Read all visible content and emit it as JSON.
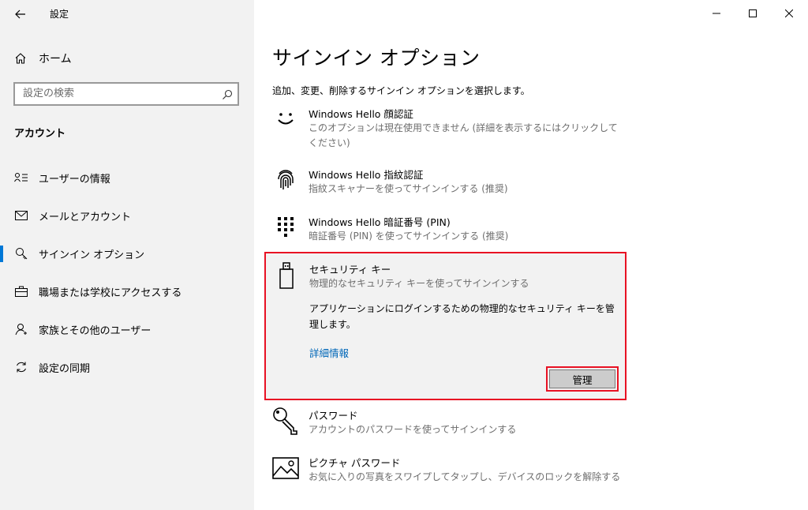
{
  "window": {
    "title": "設定",
    "back_icon": "arrow-left-icon",
    "controls": [
      "minimize-icon",
      "maximize-icon",
      "close-icon"
    ]
  },
  "sidebar": {
    "home_label": "ホーム",
    "search_placeholder": "設定の検索",
    "section_header": "アカウント",
    "items": [
      {
        "label": "ユーザーの情報",
        "icon": "user-info-icon",
        "active": false
      },
      {
        "label": "メールとアカウント",
        "icon": "mail-icon",
        "active": false
      },
      {
        "label": "サインイン オプション",
        "icon": "key-icon",
        "active": true
      },
      {
        "label": "職場または学校にアクセスする",
        "icon": "briefcase-icon",
        "active": false
      },
      {
        "label": "家族とその他のユーザー",
        "icon": "person-add-icon",
        "active": false
      },
      {
        "label": "設定の同期",
        "icon": "sync-icon",
        "active": false
      }
    ]
  },
  "main": {
    "title": "サインイン オプション",
    "description": "追加、変更、削除するサインイン オプションを選択します。",
    "options": [
      {
        "title": "Windows Hello 顔認証",
        "desc": "このオプションは現在使用できません (詳細を表示するにはクリックしてください)",
        "icon": "face-icon"
      },
      {
        "title": "Windows Hello 指紋認証",
        "desc": "指紋スキャナーを使ってサインインする (推奨)",
        "icon": "fingerprint-icon"
      },
      {
        "title": "Windows Hello 暗証番号 (PIN)",
        "desc": "暗証番号 (PIN) を使ってサインインする (推奨)",
        "icon": "pin-keypad-icon"
      },
      {
        "title": "セキュリティ キー",
        "desc": "物理的なセキュリティ キーを使ってサインインする",
        "icon": "usb-key-icon",
        "detail": "アプリケーションにログインするための物理的なセキュリティ キーを管理します。",
        "link": "詳細情報",
        "button": "管理"
      },
      {
        "title": "パスワード",
        "desc": "アカウントのパスワードを使ってサインインする",
        "icon": "password-key-icon"
      },
      {
        "title": "ピクチャ パスワード",
        "desc": "お気に入りの写真をスワイプしてタップし、デバイスのロックを解除する",
        "icon": "picture-icon"
      }
    ]
  },
  "colors": {
    "accent": "#0078d7",
    "highlight": "#e81123",
    "link": "#0067b8"
  }
}
